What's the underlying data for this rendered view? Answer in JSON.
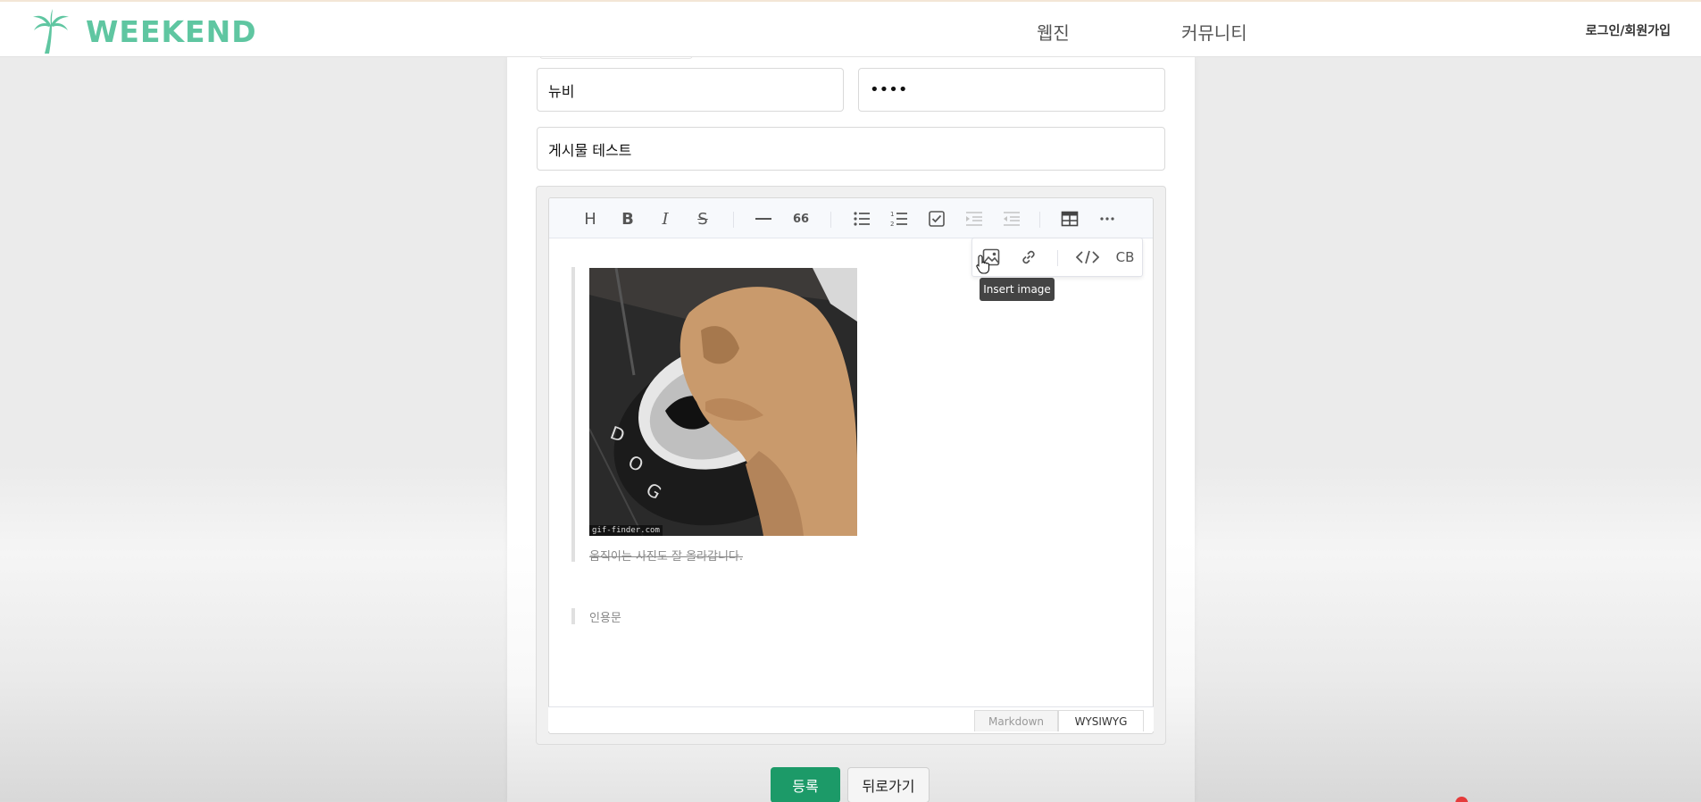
{
  "header": {
    "logo_text": "WEEKEND",
    "nav": [
      "웹진",
      "커뮤니티"
    ],
    "login_label": "로그인/회원가입",
    "brand_color": "#5fc6a1"
  },
  "form": {
    "author_value": "뉴비",
    "password_value": "••••",
    "title_value": "게시물 테스트"
  },
  "editor": {
    "toolbar": {
      "heading": "H",
      "bold": "B",
      "italic": "I",
      "strike": "S",
      "blockquote": "66",
      "codeblock": "CB"
    },
    "tooltip": "Insert image",
    "gif_watermark": "gif-finder.com",
    "caption_strike": "움직이는 사진도 잘 올라갑니다.",
    "quote_text": "인용문",
    "modes": [
      "Markdown",
      "WYSIWYG"
    ]
  },
  "actions": {
    "submit_label": "등록",
    "back_label": "뒤로가기",
    "submit_color": "#1c9a68"
  }
}
